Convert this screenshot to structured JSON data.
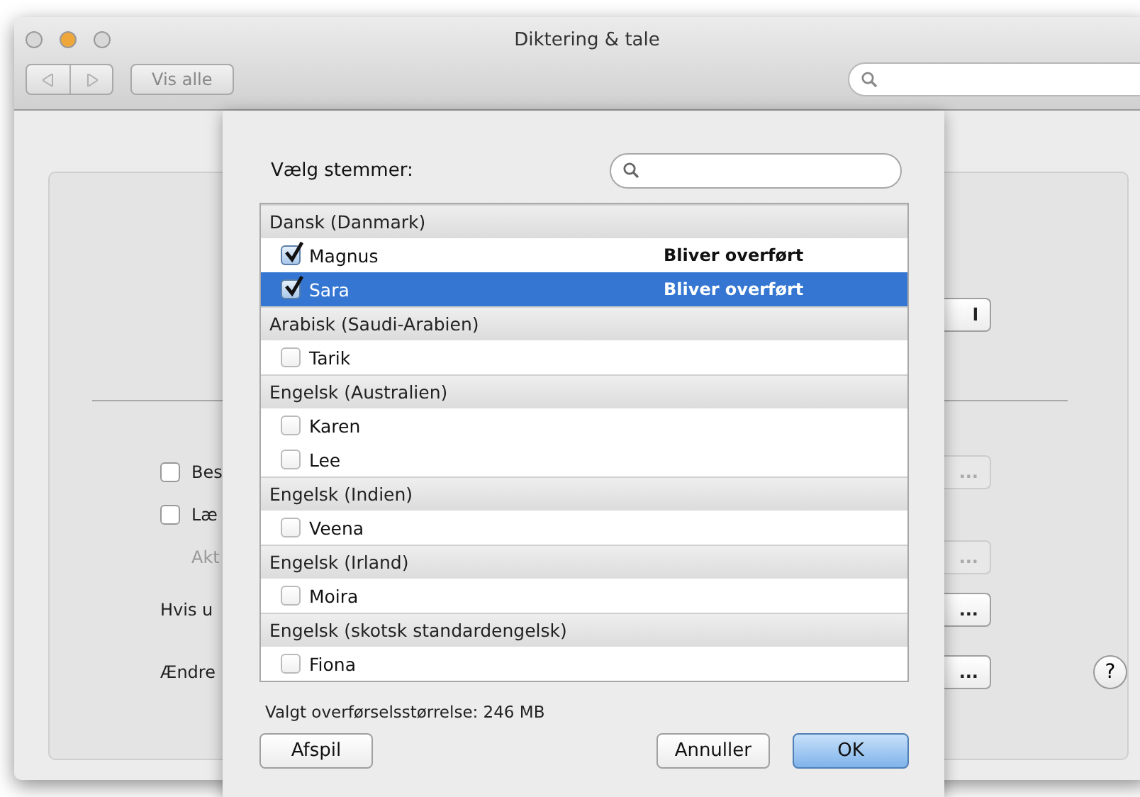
{
  "window": {
    "title": "Diktering & tale"
  },
  "toolbar": {
    "nav_back_disabled": true,
    "nav_forward_disabled": true,
    "show_all": "Vis alle"
  },
  "background": {
    "rows": [
      {
        "kind": "button",
        "button": "l",
        "disabled": false
      },
      {
        "kind": "separator"
      },
      {
        "kind": "checkbox",
        "label": "Bes",
        "checked": false,
        "button": "...",
        "disabled": true
      },
      {
        "kind": "checkbox",
        "label": "Læ",
        "checked": false
      },
      {
        "kind": "label",
        "label": "Akt",
        "button": "...",
        "disabled": true
      },
      {
        "kind": "label",
        "label": "Hvis u",
        "button": "...",
        "disabled": false
      },
      {
        "kind": "label",
        "label": "Ændre",
        "button": "...",
        "disabled": false,
        "help": "?"
      }
    ]
  },
  "sheet": {
    "label": "Vælg stemmer:",
    "groups": [
      {
        "title": "Dansk (Danmark)",
        "voices": [
          {
            "name": "Magnus",
            "checked": true,
            "selected": false,
            "status": "Bliver overført"
          },
          {
            "name": "Sara",
            "checked": true,
            "selected": true,
            "status": "Bliver overført"
          }
        ]
      },
      {
        "title": "Arabisk (Saudi-Arabien)",
        "voices": [
          {
            "name": "Tarik",
            "checked": false,
            "selected": false
          }
        ]
      },
      {
        "title": "Engelsk (Australien)",
        "voices": [
          {
            "name": "Karen",
            "checked": false,
            "selected": false
          },
          {
            "name": "Lee",
            "checked": false,
            "selected": false
          }
        ]
      },
      {
        "title": "Engelsk (Indien)",
        "voices": [
          {
            "name": "Veena",
            "checked": false,
            "selected": false
          }
        ]
      },
      {
        "title": "Engelsk (Irland)",
        "voices": [
          {
            "name": "Moira",
            "checked": false,
            "selected": false
          }
        ]
      },
      {
        "title": "Engelsk (skotsk standardengelsk)",
        "voices": [
          {
            "name": "Fiona",
            "checked": false,
            "selected": false
          }
        ]
      }
    ],
    "size": "Valgt overførselsstørrelse: 246 MB",
    "buttons": [
      {
        "label": "Afspil",
        "kind": "normal"
      },
      {
        "label": "Annuller",
        "kind": "normal"
      },
      {
        "label": "OK",
        "kind": "default"
      }
    ]
  }
}
